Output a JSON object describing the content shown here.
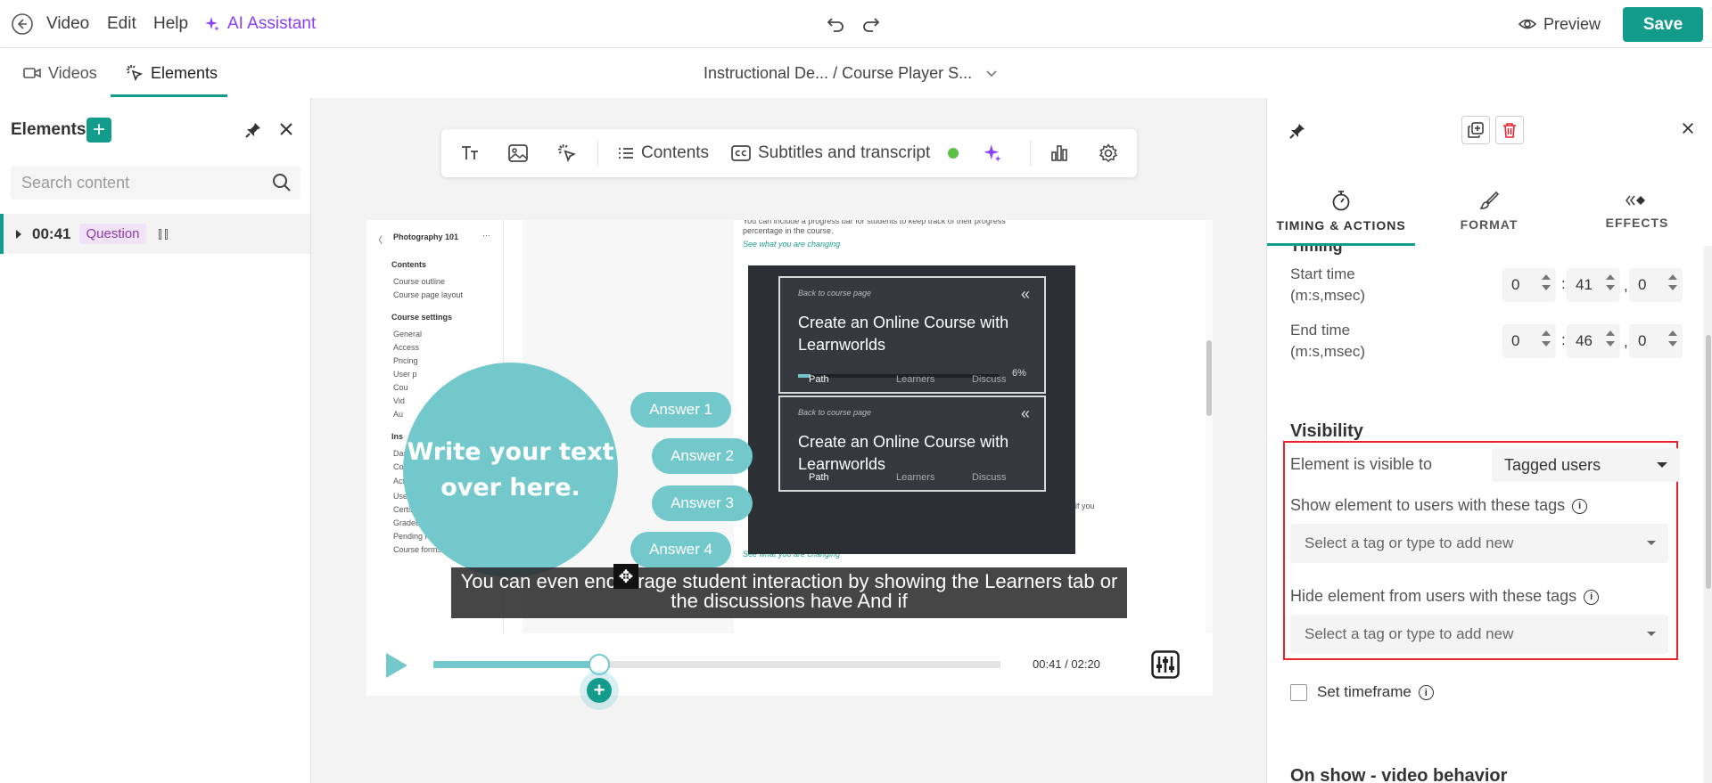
{
  "topbar": {
    "video_label": "Video",
    "edit_label": "Edit",
    "help_label": "Help",
    "ai_label": "AI Assistant",
    "preview_label": "Preview",
    "save_label": "Save"
  },
  "subbar": {
    "tabs": [
      {
        "label": "Videos"
      },
      {
        "label": "Elements"
      }
    ],
    "breadcrumb": "Instructional De...  / Course Player S..."
  },
  "left_panel": {
    "title": "Elements",
    "search_placeholder": "Search content",
    "items": [
      {
        "time": "00:41",
        "type": "Question"
      }
    ]
  },
  "toolbar": {
    "contents_label": "Contents",
    "subtitles_label": "Subtitles and transcript"
  },
  "video": {
    "sidebar": {
      "course": "Photography 101",
      "contents_heading": "Contents",
      "contents_items": [
        "Course outline",
        "Course page layout"
      ],
      "settings_heading": "Course settings",
      "settings_items": [
        "General",
        "Access",
        "Pricing",
        "User p",
        "Cou",
        "Vid",
        "Au"
      ],
      "insights_heading": "Ins",
      "insights_items": [
        "Dash",
        "Course",
        "Activity Matri",
        "Users",
        "Certificates",
        "Gradebook",
        "Pending reviews",
        "Course forms"
      ]
    },
    "right_text_top": "You can include a progress bar for students to keep track of their progress percentage in the course.",
    "link_text": "See what you are changing",
    "right_text_bottom": "Applicable only if you App nvagable.",
    "cards": [
      {
        "back": "Back to course page",
        "title": "Create an Online Course with Learnworlds",
        "progress_pct": "6%",
        "progress": 0.06,
        "tabs": [
          "Path",
          "Learners",
          "Discuss"
        ]
      },
      {
        "back": "Back to course page",
        "title": "Create an Online Course with Learnworlds",
        "tabs": [
          "Path",
          "Learners",
          "Discuss"
        ]
      }
    ],
    "circle_text": "Write your text over here.",
    "answers": [
      "Answer 1",
      "Answer 2",
      "Answer 3",
      "Answer 4"
    ],
    "subtitle": "You can even encourage student interaction by showing the Learners tab or the discussions have And if",
    "time_display": "00:41 / 02:20",
    "progress": 0.293
  },
  "right_panel": {
    "tabs": [
      {
        "label": "TIMING & ACTIONS"
      },
      {
        "label": "FORMAT"
      },
      {
        "label": "EFFECTS"
      }
    ],
    "cut_heading": "Timing",
    "start_label": "Start time",
    "end_label": "End time",
    "unit_label": "(m:s,msec)",
    "start": {
      "m": "0",
      "s": "41",
      "ms": "0"
    },
    "end": {
      "m": "0",
      "s": "46",
      "ms": "0"
    },
    "visibility_heading": "Visibility",
    "visible_to_label": "Element is visible to",
    "visible_to_value": "Tagged users",
    "show_tags_label": "Show element to users with these tags",
    "hide_tags_label": "Hide element from users with these tags",
    "tag_placeholder": "Select a tag or type to add new",
    "timeframe_label": "Set timeframe",
    "on_show_heading": "On show - video behavior"
  },
  "colors": {
    "brand": "#139b8c",
    "accent_purple": "#8a3ffc",
    "teal_shape": "#73c8cc",
    "highlight_red": "#e8232d"
  }
}
